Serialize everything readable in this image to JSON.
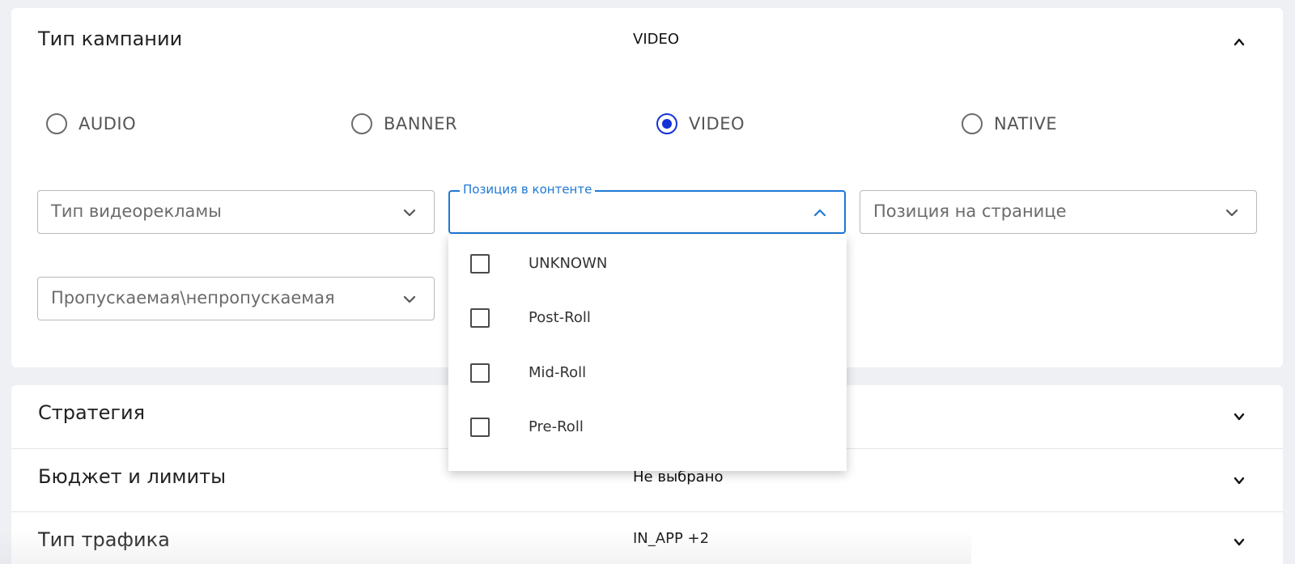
{
  "campaign_type": {
    "title": "Тип кампании",
    "value": "VIDEO",
    "radios": [
      {
        "label": "AUDIO",
        "checked": false
      },
      {
        "label": "BANNER",
        "checked": false
      },
      {
        "label": "VIDEO",
        "checked": true
      },
      {
        "label": "NATIVE",
        "checked": false
      }
    ],
    "fields": {
      "video_ad_type": {
        "placeholder": "Тип видеорекламы"
      },
      "content_position": {
        "label": "Позиция в контенте",
        "value": ""
      },
      "page_position": {
        "placeholder": "Позиция на странице"
      },
      "skippable": {
        "placeholder": "Пропускаемая\\непропускаемая"
      }
    },
    "dropdown_options": [
      {
        "label": "UNKNOWN",
        "checked": false
      },
      {
        "label": "Post-Roll",
        "checked": false
      },
      {
        "label": "Mid-Roll",
        "checked": false
      },
      {
        "label": "Pre-Roll",
        "checked": false
      }
    ]
  },
  "sections": [
    {
      "title": "Стратегия",
      "value": ""
    },
    {
      "title": "Бюджет и лимиты",
      "value": "Не выбрано"
    },
    {
      "title": "Тип трафика",
      "value": "IN_APP +2"
    }
  ],
  "icons": {
    "collapse": "chevron-up-icon",
    "expand": "chevron-down-icon"
  },
  "colors": {
    "accent": "#1e78d6",
    "radio_selected": "#1432d6",
    "background": "#eef0f4"
  }
}
